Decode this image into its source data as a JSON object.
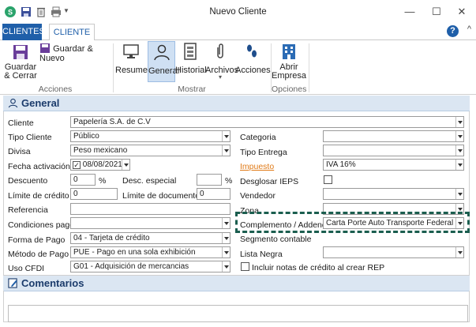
{
  "window": {
    "title": "Nuevo Cliente",
    "controls": {
      "minimize": "—",
      "maximize": "☐",
      "close": "✕"
    }
  },
  "ribbon_tabs": {
    "clientes": "CLIENTES",
    "cliente": "CLIENTE",
    "help": "?",
    "collapse": "^"
  },
  "ribbon": {
    "guardar_cerrar": "Guardar & Cerrar",
    "guardar_nuevo": "Guardar & Nuevo",
    "acciones_group": "Acciones",
    "resumen": "Resumen",
    "general": "General",
    "historial": "Historial",
    "archivos": "Archivos",
    "acciones": "Acciones",
    "mostrar_group": "Mostrar",
    "abrir_empresa": "Abrir Empresa",
    "opciones_group": "Opciones"
  },
  "sections": {
    "general": "General",
    "comentarios": "Comentarios"
  },
  "form": {
    "cliente_label": "Cliente",
    "cliente_value": "Papelería S.A. de C.V",
    "tipo_cliente_label": "Tipo Cliente",
    "tipo_cliente_value": "Público",
    "divisa_label": "Divisa",
    "divisa_value": "Peso mexicano",
    "fecha_activacion_label": "Fecha activación",
    "fecha_activacion_value": "08/08/2021",
    "descuento_label": "Descuento",
    "descuento_value": "0",
    "descuento_unit": "%",
    "desc_especial_label": "Desc. especial",
    "desc_especial_value": "",
    "desc_especial_unit": "%",
    "limite_credito_label": "Límite de crédito",
    "limite_credito_value": "0",
    "limite_documentos_label": "Límite de documentos",
    "limite_documentos_value": "0",
    "referencia_label": "Referencia",
    "referencia_value": "",
    "condiciones_pago_label": "Condiciones pago",
    "condiciones_pago_value": "",
    "forma_pago_label": "Forma de Pago",
    "forma_pago_value": "04 - Tarjeta de crédito",
    "metodo_pago_label": "Método de Pago",
    "metodo_pago_value": "PUE - Pago en una sola exhibición",
    "uso_cfdi_label": "Uso CFDI",
    "uso_cfdi_value": "G01 - Adquisición de mercancias",
    "categoria_label": "Categoria",
    "categoria_value": "",
    "tipo_entrega_label": "Tipo Entrega",
    "tipo_entrega_value": "",
    "impuesto_label": "Impuesto",
    "impuesto_value": "IVA 16%",
    "desglosar_ieps_label": "Desglosar IEPS",
    "vendedor_label": "Vendedor",
    "vendedor_value": "",
    "zona_label": "Zona",
    "zona_value": "",
    "complemento_label": "Complemento / Addenda",
    "complemento_value": "Carta Porte Auto Transporte Federal",
    "segmento_label": "Segmento contable",
    "lista_negra_label": "Lista Negra",
    "lista_negra_value": "",
    "incluir_notas_label": "Incluir notas de crédito al crear REP"
  },
  "colors": {
    "accent": "#1f5fa9",
    "section_bg": "#dbe6f2",
    "highlight": "#1b5e4f",
    "link": "#e07a17"
  }
}
